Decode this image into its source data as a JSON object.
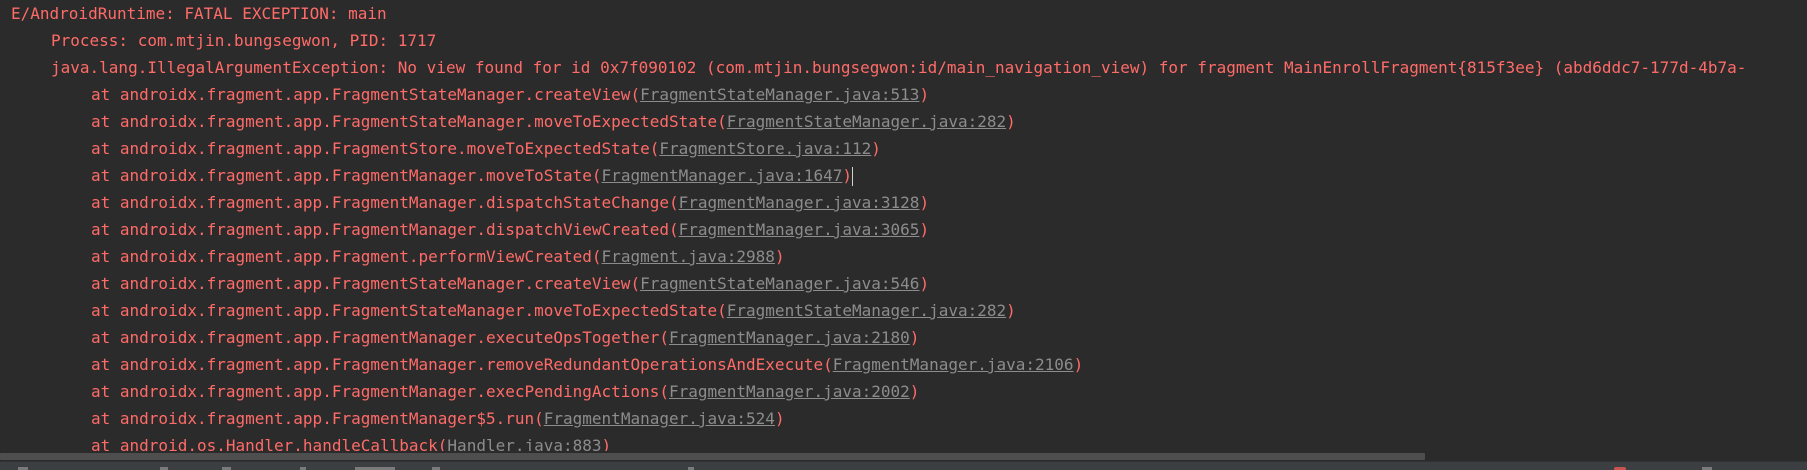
{
  "log": {
    "header": "E/AndroidRuntime: FATAL EXCEPTION: main",
    "process": "Process: com.mtjin.bungsegwon, PID: 1717",
    "exception": "java.lang.IllegalArgumentException: No view found for id 0x7f090102 (com.mtjin.bungsegwon:id/main_navigation_view) for fragment MainEnrollFragment{815f3ee} (abd6ddc7-177d-4b7a-",
    "frames": [
      {
        "prefix": "at androidx.fragment.app.FragmentStateManager.createView(",
        "link": "FragmentStateManager.java:513",
        "suffix": ")"
      },
      {
        "prefix": "at androidx.fragment.app.FragmentStateManager.moveToExpectedState(",
        "link": "FragmentStateManager.java:282",
        "suffix": ")"
      },
      {
        "prefix": "at androidx.fragment.app.FragmentStore.moveToExpectedState(",
        "link": "FragmentStore.java:112",
        "suffix": ")"
      },
      {
        "prefix": "at androidx.fragment.app.FragmentManager.moveToState(",
        "link": "FragmentManager.java:1647",
        "suffix": ")"
      },
      {
        "prefix": "at androidx.fragment.app.FragmentManager.dispatchStateChange(",
        "link": "FragmentManager.java:3128",
        "suffix": ")"
      },
      {
        "prefix": "at androidx.fragment.app.FragmentManager.dispatchViewCreated(",
        "link": "FragmentManager.java:3065",
        "suffix": ")"
      },
      {
        "prefix": "at androidx.fragment.app.Fragment.performViewCreated(",
        "link": "Fragment.java:2988",
        "suffix": ")"
      },
      {
        "prefix": "at androidx.fragment.app.FragmentStateManager.createView(",
        "link": "FragmentStateManager.java:546",
        "suffix": ")"
      },
      {
        "prefix": "at androidx.fragment.app.FragmentStateManager.moveToExpectedState(",
        "link": "FragmentStateManager.java:282",
        "suffix": ")"
      },
      {
        "prefix": "at androidx.fragment.app.FragmentManager.executeOpsTogether(",
        "link": "FragmentManager.java:2180",
        "suffix": ")"
      },
      {
        "prefix": "at androidx.fragment.app.FragmentManager.removeRedundantOperationsAndExecute(",
        "link": "FragmentManager.java:2106",
        "suffix": ")"
      },
      {
        "prefix": "at androidx.fragment.app.FragmentManager.execPendingActions(",
        "link": "FragmentManager.java:2002",
        "suffix": ")"
      },
      {
        "prefix": "at androidx.fragment.app.FragmentManager$5.run(",
        "link": "FragmentManager.java:524",
        "suffix": ")"
      },
      {
        "prefix": "at android.os.Handler.handleCallback(",
        "link": "Handler.java:883",
        "suffix": ")"
      }
    ]
  },
  "colors": {
    "background": "#2b2b2b",
    "error_text": "#ff6b68",
    "link_text": "#8c8c8c"
  }
}
